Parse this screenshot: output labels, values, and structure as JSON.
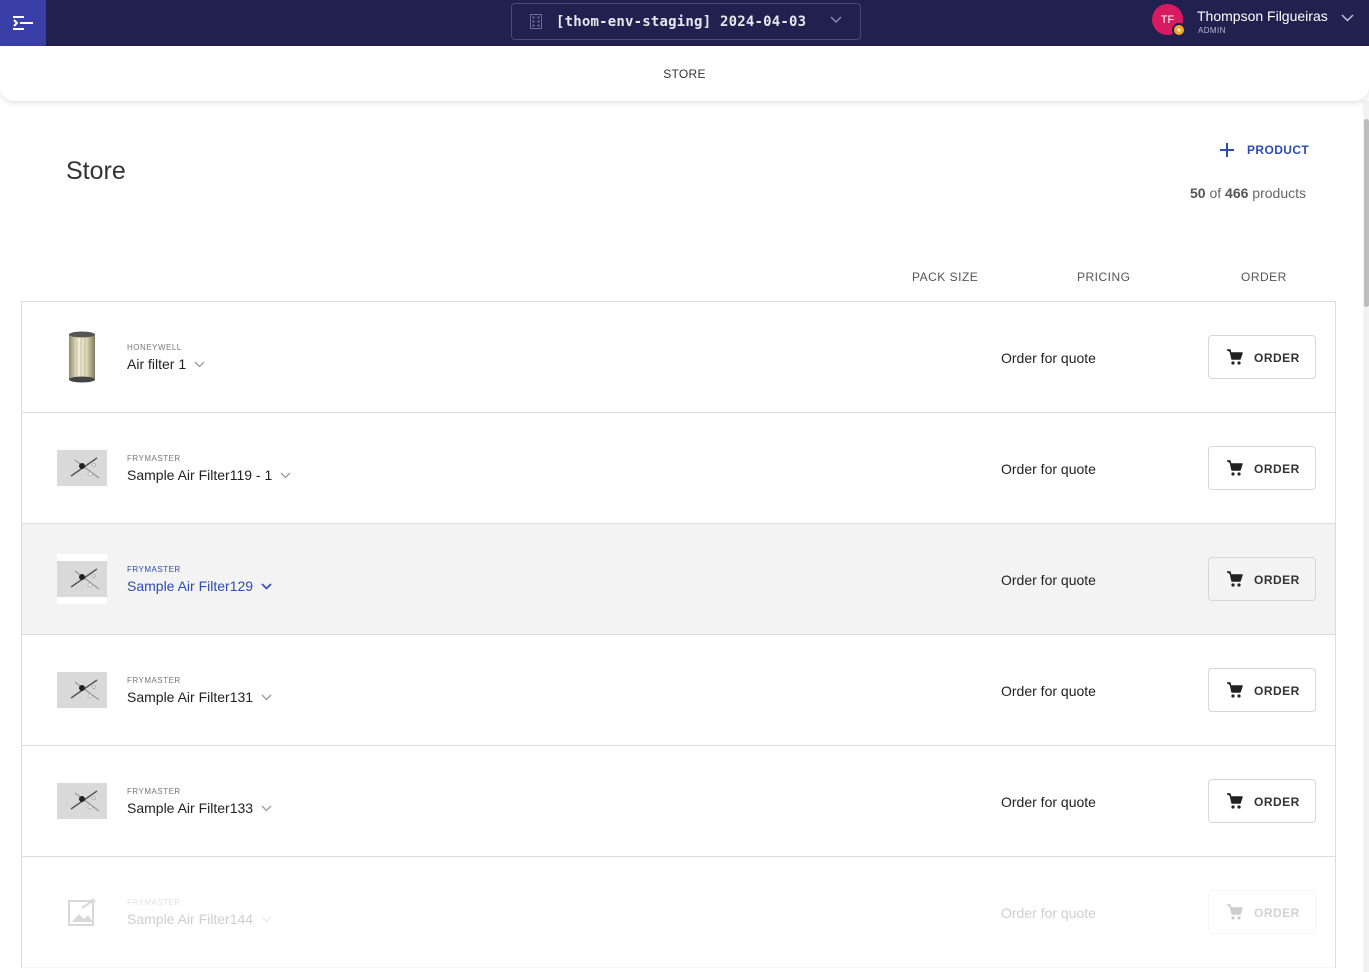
{
  "topbar": {
    "menu_icon": "menu-open-icon",
    "environment": "[thom-env-staging] 2024-04-03",
    "environment_icon": "building-icon",
    "user": {
      "initials": "TF",
      "name": "Thompson Filgueiras",
      "role": "ADMIN"
    },
    "colors": {
      "bar": "#21204f",
      "menu_button": "#3a3fa8",
      "avatar": "#d81b60",
      "badge": "#f9a825"
    }
  },
  "subheader": {
    "section": "STORE"
  },
  "page": {
    "title": "Store",
    "add_product_label": "PRODUCT",
    "count": {
      "shown": "50",
      "of_word": "of",
      "total": "466",
      "unit": "products"
    }
  },
  "columns": {
    "pack_size": "PACK SIZE",
    "pricing": "PRICING",
    "order": "ORDER"
  },
  "products": [
    {
      "brand": "HONEYWELL",
      "name": "Air filter 1",
      "pricing": "Order for quote",
      "order_label": "ORDER",
      "image": "cylinder-filter"
    },
    {
      "brand": "FRYMASTER",
      "name": "Sample Air Filter119 - 1",
      "pricing": "Order for quote",
      "order_label": "ORDER",
      "image": "tool-photo"
    },
    {
      "brand": "FRYMASTER",
      "name": "Sample Air Filter129",
      "pricing": "Order for quote",
      "order_label": "ORDER",
      "image": "tool-photo",
      "state": "hover"
    },
    {
      "brand": "FRYMASTER",
      "name": "Sample Air Filter131",
      "pricing": "Order for quote",
      "order_label": "ORDER",
      "image": "tool-photo"
    },
    {
      "brand": "FRYMASTER",
      "name": "Sample Air Filter133",
      "pricing": "Order for quote",
      "order_label": "ORDER",
      "image": "tool-photo"
    },
    {
      "brand": "FRYMASTER",
      "name": "Sample Air Filter144",
      "pricing": "Order for quote",
      "order_label": "ORDER",
      "image": "no-image",
      "state": "loading"
    }
  ],
  "accent_color": "#2c4bb3"
}
